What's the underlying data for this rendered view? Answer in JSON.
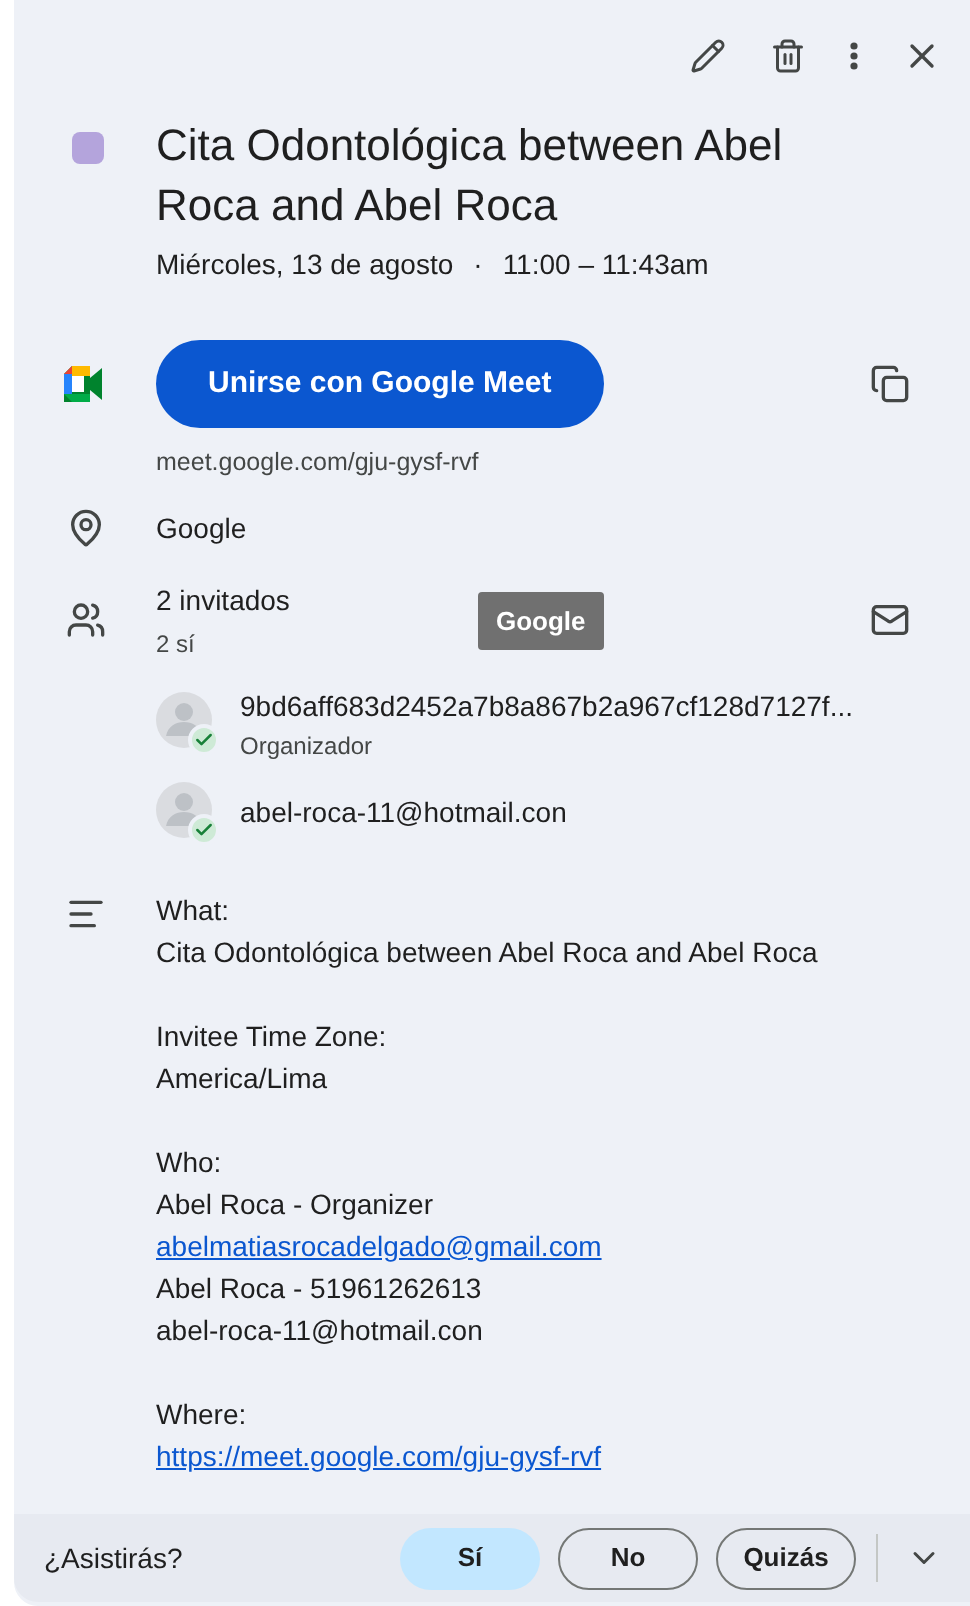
{
  "event": {
    "color": "#b4a4dc",
    "title": "Cita Odontológica between Abel Roca and Abel Roca",
    "date": "Miércoles, 13 de agosto",
    "separator": "·",
    "time": "11:00 – 11:43am"
  },
  "meet": {
    "button": "Unirse con Google Meet",
    "url": "meet.google.com/gju-gysf-rvf"
  },
  "location": "Google",
  "guests": {
    "summary": "2 invitados",
    "responses": "2 sí",
    "tooltip": "Google",
    "list": [
      {
        "name": "9bd6aff683d2452a7b8a867b2a967cf128d7127f...",
        "role": "Organizador",
        "accepted": true
      },
      {
        "name": "abel-roca-11@hotmail.con",
        "accepted": true
      }
    ]
  },
  "description": [
    [
      {
        "kind": "text",
        "text": "What:"
      },
      {
        "kind": "text",
        "text": "Cita Odontológica between Abel Roca and Abel Roca"
      }
    ],
    [
      {
        "kind": "text",
        "text": "Invitee Time Zone:"
      },
      {
        "kind": "text",
        "text": "America/Lima"
      }
    ],
    [
      {
        "kind": "text",
        "text": "Who:"
      },
      {
        "kind": "text",
        "text": "Abel Roca - Organizer"
      },
      {
        "kind": "link",
        "text": "abelmatiasrocadelgado@gmail.com"
      },
      {
        "kind": "text",
        "text": "Abel Roca - 51961262613"
      },
      {
        "kind": "text",
        "text": "abel-roca-11@hotmail.con"
      }
    ],
    [
      {
        "kind": "text",
        "text": "Where:"
      },
      {
        "kind": "link",
        "text": "https://meet.google.com/gju-gysf-rvf"
      }
    ]
  ],
  "rsvp": {
    "question": "¿Asistirás?",
    "options": [
      {
        "label": "Sí",
        "selected": true
      },
      {
        "label": "No",
        "selected": false
      },
      {
        "label": "Quizás",
        "selected": false
      }
    ]
  }
}
